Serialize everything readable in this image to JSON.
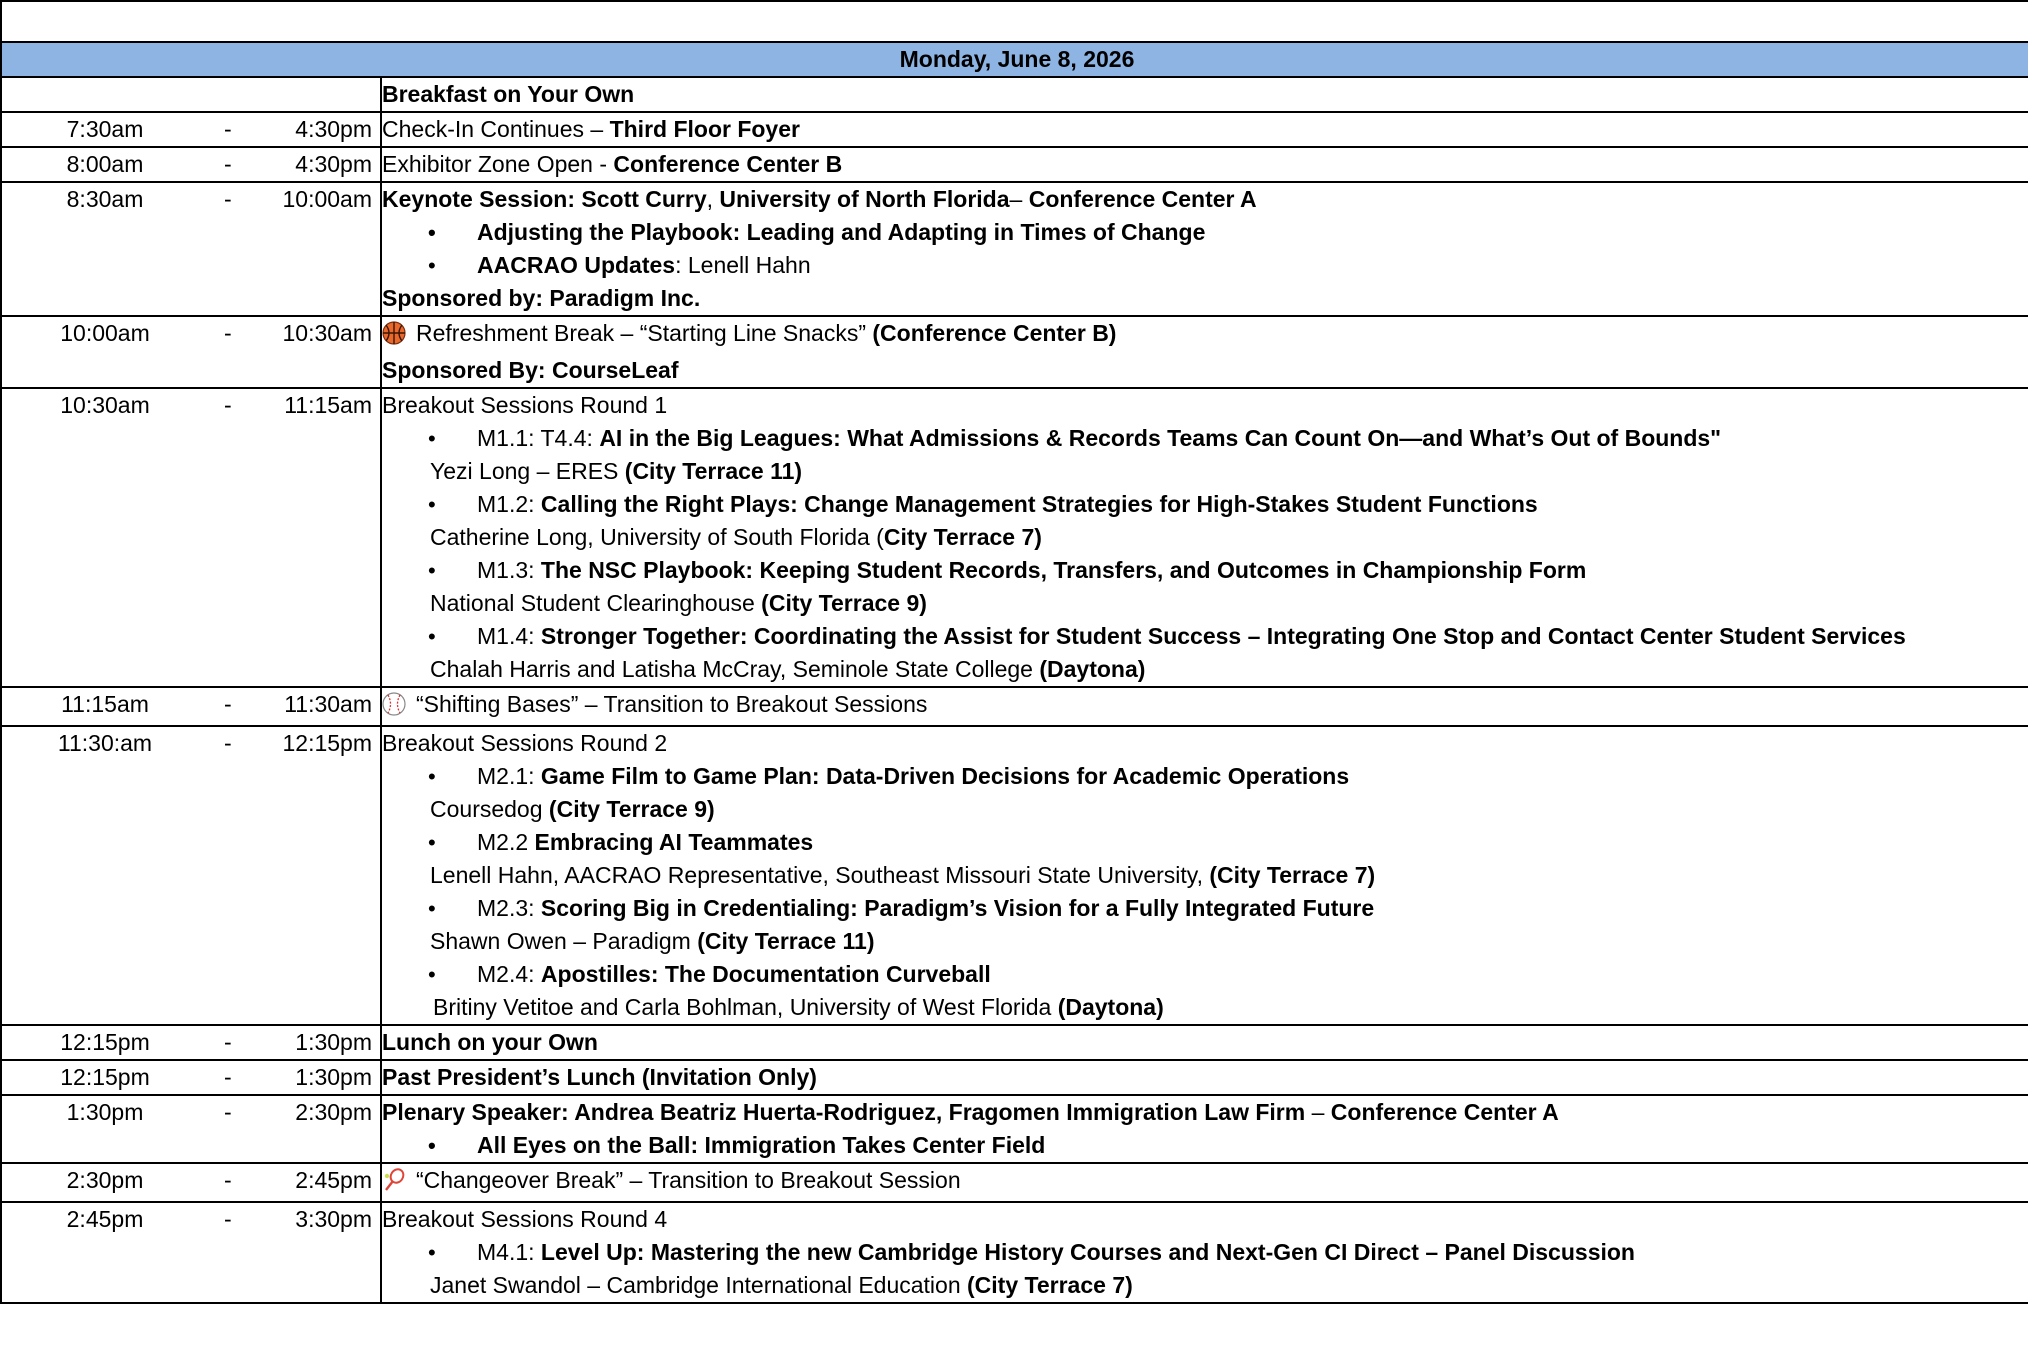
{
  "day_header": "Monday, June 8, 2026",
  "rows": [
    {
      "start": "",
      "end": "",
      "title": "Breakfast on Your Own"
    },
    {
      "start": "7:30am",
      "end": "4:30pm",
      "text": "Check-In Continues – ",
      "loc": "Third Floor Foyer"
    },
    {
      "start": "8:00am",
      "end": "4:30pm",
      "text": "Exhibitor Zone Open - ",
      "loc": "Conference Center B"
    },
    {
      "start": "8:30am",
      "end": "10:00am",
      "lead": "Keynote Session: Scott Curry",
      "sep": ", ",
      "org": "University of North Florida",
      "sep2": "– ",
      "loc": "Conference Center A",
      "bullet1": "Adjusting the Playbook: Leading and Adapting in Times of Change",
      "bullet2_bold": "AACRAO Updates",
      "bullet2_rest": ": Lenell Hahn",
      "sponsor": "Sponsored by: Paradigm Inc."
    },
    {
      "start": "10:00am",
      "end": "10:30am",
      "icon": "basketball-icon",
      "text": "Refreshment Break – “Starting Line Snacks” ",
      "loc": "(Conference Center B)",
      "sponsor": "Sponsored By: CourseLeaf"
    },
    {
      "start": "10:30am",
      "end": "11:15am",
      "heading": "Breakout Sessions Round 1",
      "sessions": [
        {
          "code": "M1.1: T4.4: ",
          "title": "AI in the Big Leagues: What Admissions & Records Teams Can Count On—and What’s Out of Bounds\"",
          "presenter": "Yezi Long – ERES ",
          "room": "(City Terrace 11)",
          "room_pre": "",
          "room_post": ""
        },
        {
          "code": "M1.2: ",
          "title": "Calling the Right Plays: Change Management Strategies for High-Stakes Student Functions",
          "presenter": "Catherine Long, University of South Florida (",
          "room": "City Terrace 7)",
          "room_pre": "",
          "room_post": ""
        },
        {
          "code": "M1.3: ",
          "title": "The NSC Playbook: Keeping Student Records, Transfers, and Outcomes in Championship Form",
          "presenter": "National Student Clearinghouse ",
          "room": "(City Terrace 9)",
          "room_pre": "",
          "room_post": ""
        },
        {
          "code": "M1.4: ",
          "title": "Stronger Together: Coordinating the Assist for Student Success – Integrating One Stop and Contact Center Student Services",
          "presenter": "Chalah Harris and Latisha McCray, Seminole State College ",
          "room": "(Daytona)",
          "room_pre": "",
          "room_post": ""
        }
      ]
    },
    {
      "start": "11:15am",
      "end": "11:30am",
      "icon": "baseball-icon",
      "text": "“Shifting Bases” – Transition to Breakout Sessions"
    },
    {
      "start": "11:30:am",
      "end": "12:15pm",
      "heading": "Breakout Sessions Round 2",
      "sessions": [
        {
          "code": "M2.1: ",
          "title": "Game Film to Game Plan: Data-Driven Decisions for Academic Operations",
          "presenter": "Coursedog ",
          "room": "(City Terrace 9)"
        },
        {
          "code": "M2.2 ",
          "title": "Embracing AI Teammates",
          "presenter": "Lenell Hahn, AACRAO Representative, Southeast Missouri State University, ",
          "room": "(City Terrace 7)"
        },
        {
          "code": "M2.3: ",
          "title": "Scoring Big in Credentialing: Paradigm’s Vision for a Fully Integrated Future",
          "presenter": "Shawn Owen – Paradigm ",
          "room": "(City Terrace 11)"
        },
        {
          "code": "M2.4: ",
          "title": "Apostilles: The Documentation Curveball",
          "presenter": "Britiny Vetitoe and Carla Bohlman, University of West Florida ",
          "room": "(Daytona)"
        }
      ]
    },
    {
      "start": "12:15pm",
      "end": "1:30pm",
      "title": "Lunch on your Own"
    },
    {
      "start": "12:15pm",
      "end": "1:30pm",
      "title": "Past President’s Lunch (Invitation Only)"
    },
    {
      "start": "1:30pm",
      "end": "2:30pm",
      "lead": "Plenary Speaker: Andrea Beatriz Huerta-Rodriguez, Fragomen Immigration Law Firm",
      "sep": " – ",
      "loc": "Conference Center A",
      "bullet1": "All Eyes on the Ball: Immigration Takes Center Field"
    },
    {
      "start": "2:30pm",
      "end": "2:45pm",
      "icon": "tennis-racket-icon",
      "text": "“Changeover Break” – Transition to Breakout Session"
    },
    {
      "start": "2:45pm",
      "end": "3:30pm",
      "heading": "Breakout Sessions Round 4",
      "sessions": [
        {
          "code": "M4.1: ",
          "title": "Level Up: Mastering the new Cambridge History Courses and Next-Gen CI Direct – Panel Discussion",
          "presenter": "Janet Swandol – Cambridge International Education ",
          "room": "(City Terrace 7)"
        }
      ]
    }
  ]
}
